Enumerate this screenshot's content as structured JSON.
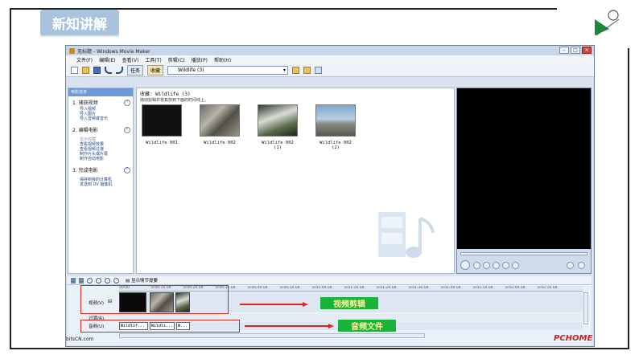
{
  "slide": {
    "title": "新知讲解"
  },
  "window": {
    "title": "无标题 - Windows Movie Maker",
    "menu": [
      "文件(F)",
      "编辑(E)",
      "查看(V)",
      "工具(T)",
      "剪辑(C)",
      "播放(P)",
      "帮助(H)"
    ],
    "toolbar": {
      "tasks_label": "任务",
      "collections_label": "收藏",
      "collection_dropdown": "Wildlife (3)"
    }
  },
  "tasks_pane": {
    "header": "电影任务",
    "sections": [
      {
        "title": "1. 捕获视频",
        "links": [
          "导入视频",
          "导入图片",
          "导入音频或音乐"
        ]
      },
      {
        "title": "2. 编辑电影",
        "links": [
          "显示收藏",
          "查看视频效果",
          "查看视频过渡",
          "制作片头或片尾",
          "制作自动电影"
        ]
      },
      {
        "title": "3. 完成电影",
        "links": [
          "保存到我的计算机",
          "发送到 DV 摄像机"
        ]
      }
    ]
  },
  "collection": {
    "title": "收藏: Wildlife (3)",
    "hint": "拖动剪辑并将其放到下面的时间线上。",
    "clips": [
      {
        "name": "Wildlife 001"
      },
      {
        "name": "Wildlife 002"
      },
      {
        "name": "Wildlife 002 (1)"
      },
      {
        "name": "Wildlife 002 (2)"
      }
    ]
  },
  "timeline": {
    "storyboard_label": "显示情节提要",
    "ruler_ticks": [
      "00:00",
      "0:00:10.00",
      "0:00:20.00",
      "0:00:30.00",
      "0:00:40.00",
      "0:00:50.00",
      "0:01:00.00",
      "0:01:10.00",
      "0:01:20.00",
      "0:01:30.00",
      "0:01:40.00",
      "0:01:50.00",
      "0:02:00.00",
      "0:02:10.00"
    ],
    "video_track_label": "视频(V)",
    "transition_track_label": "过渡(R)",
    "audio_track_label": "音频(U)",
    "audio_clips": [
      "Wildlif...",
      "Wildli...",
      "W..."
    ]
  },
  "annotations": {
    "video_edit_label": "视频剪辑",
    "audio_file_label": "音频文件",
    "colors": {
      "red": "#d9261c",
      "green": "#18b43a",
      "text_yellow": "#fff59d"
    }
  },
  "watermarks": {
    "left": "bitsCN.com",
    "right": "PCHOME"
  }
}
